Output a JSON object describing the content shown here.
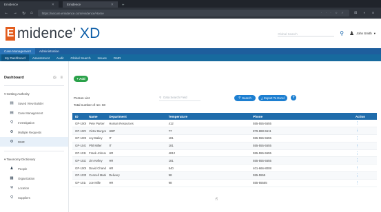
{
  "browser": {
    "tabs": [
      {
        "label": "Emidence"
      },
      {
        "label": "Emidence"
      }
    ],
    "url": "https://secure.emidence.com/evidence/Home",
    "url_extra": "· · ·   ☆   ✓"
  },
  "app": {
    "logo_mark": "E",
    "logo_word": "midence",
    "logo_suffix": "XD",
    "search_placeholder": "Global Search",
    "user_name": "John Smith"
  },
  "nav": {
    "primary": [
      "Case Management",
      "Administration"
    ],
    "secondary": [
      "My Dashboard",
      "Assessment",
      "Audit",
      "Global Search",
      "Issues",
      "DMR"
    ]
  },
  "sidebar": {
    "title": "Dashboard",
    "groups": [
      {
        "label": "▾ Getting Authority",
        "items": [
          {
            "icon": "▤",
            "label": "Saved View Builder"
          },
          {
            "icon": "▤",
            "label": "Case Management"
          },
          {
            "icon": "⚲",
            "label": "Investigation"
          },
          {
            "icon": "⚙",
            "label": "Multiple Requests"
          },
          {
            "icon": "⚙",
            "label": "DMR"
          }
        ]
      },
      {
        "label": "▾ Taxonomy Dictionary",
        "items": [
          {
            "icon": "♟",
            "label": "People"
          },
          {
            "icon": "▦",
            "label": "Organization"
          },
          {
            "icon": "⚲",
            "label": "Location"
          },
          {
            "icon": "⚲",
            "label": "Suppliers"
          }
        ]
      }
    ]
  },
  "main": {
    "add_label": "+ Add",
    "list_label": "Person List",
    "search_placeholder": "Data Search Field",
    "btn_search": "Search",
    "btn_export": "Export To Excel",
    "help_label": "?",
    "records": "Total number of rec: 60",
    "columns": [
      "ID",
      "Name",
      "Department",
      "Temperature",
      "Phone",
      "Action"
    ],
    "rows": [
      [
        "GP-1009",
        "Pete Parker",
        "Human Resources",
        "412",
        "555-555-5555",
        "⋮"
      ],
      [
        "GP-1003",
        "Victor Burgos",
        "HBP",
        "77",
        "879-888-5511",
        "⋮"
      ],
      [
        "GP-1008",
        "Joy Bailey",
        "IT",
        "181",
        "555-555-5555",
        "⋮"
      ],
      [
        "GP-1047",
        "Phil Miller",
        "IT",
        "181",
        "555-555-5555",
        "⋮"
      ],
      [
        "GP-1012",
        "Frank Johnson",
        "HR",
        "4812",
        "555-555-5555",
        "⋮"
      ],
      [
        "GP-1023",
        "Jim Kelley",
        "HR",
        "181",
        "555-555-5555",
        "⋮"
      ],
      [
        "GP-1009",
        "David Chandarnold",
        "HR",
        "540",
        "401-666-8008",
        "⋮"
      ],
      [
        "GP-1035",
        "Connell Marks",
        "Delivery",
        "98",
        "555-5555",
        "⋮"
      ],
      [
        "GP-1014",
        "Joe Mille",
        "HR",
        "98",
        "555-55555",
        "⋮"
      ]
    ]
  }
}
